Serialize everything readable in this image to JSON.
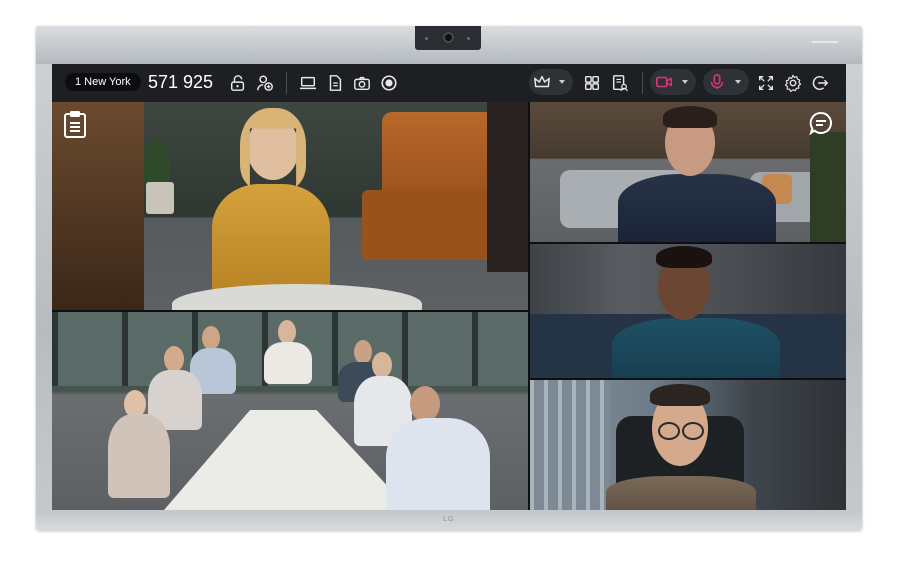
{
  "toolbar": {
    "room_name": "1 New York",
    "meeting_id": "571 925",
    "left_icons": [
      "lock-icon",
      "add-participant-icon",
      "share-screen-icon",
      "document-icon",
      "camera-icon",
      "record-icon"
    ],
    "right_icons": [
      "crown-icon",
      "layout-grid-icon",
      "participants-list-icon",
      "video-camera-icon",
      "microphone-icon",
      "fullscreen-icon",
      "settings-icon",
      "leave-icon"
    ],
    "video_color": "#e0337e",
    "mic_color": "#e0337e"
  },
  "overlays": {
    "left_icon": "notes-icon",
    "right_icon": "chat-icon"
  },
  "tiles": [
    {
      "name": "speaker-tile-woman-yellow",
      "wall": "#3f4a44",
      "floor": "#5b5d60"
    },
    {
      "name": "participant-tile-man-navy",
      "wall": "#4a3d30",
      "floor": "#6c5a48"
    },
    {
      "name": "participant-tile-man-teal",
      "wall": "#3d4247",
      "floor": "#2d3a45"
    },
    {
      "name": "conference-room-tile",
      "wall": "#3a4a48",
      "floor": "#6d7172"
    },
    {
      "name": "participant-tile-man-glasses",
      "wall": "#4d5a66",
      "floor": "#3a3d40"
    }
  ],
  "brand_logo": "LG"
}
